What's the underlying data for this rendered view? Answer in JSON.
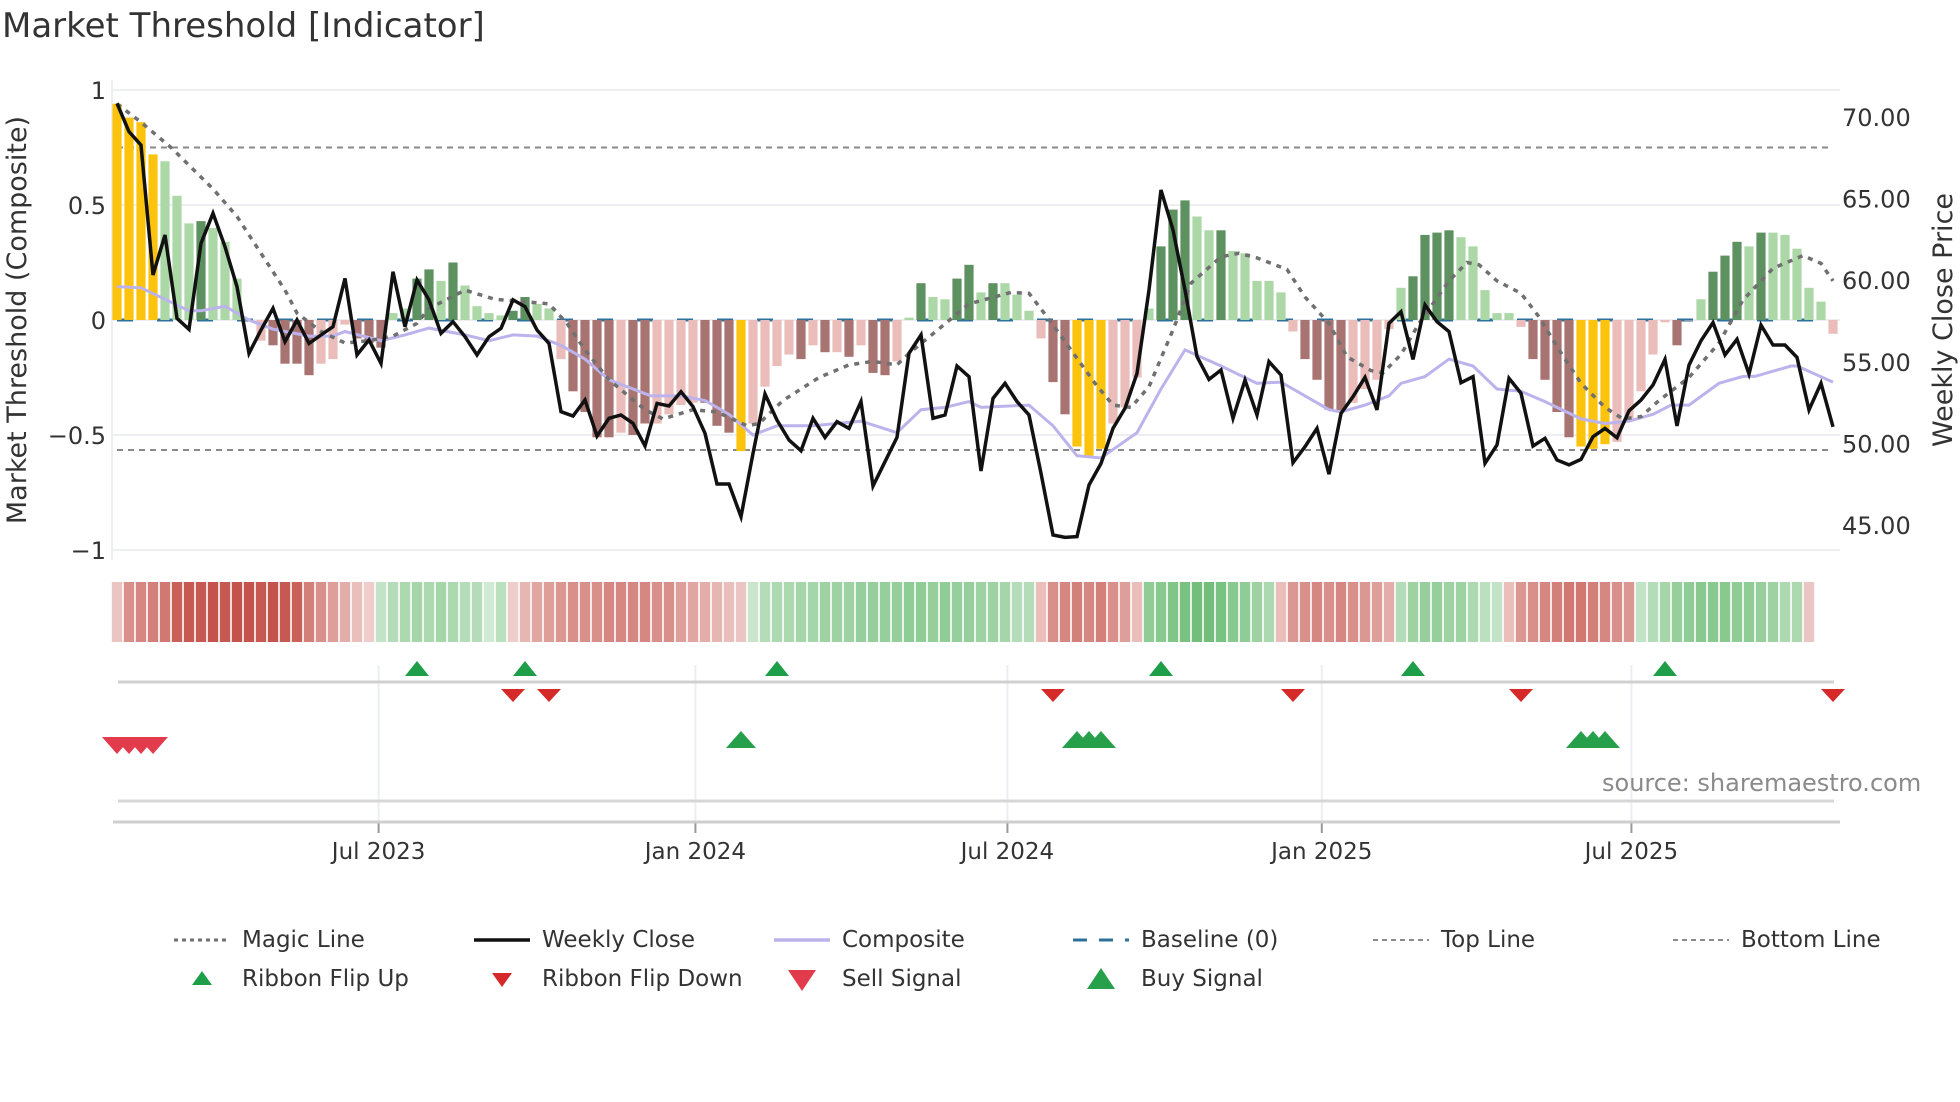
{
  "title": "Market Threshold [Indicator]",
  "source": "source: sharemaestro.com",
  "legend": {
    "magic": "Magic Line",
    "close": "Weekly Close",
    "composite": "Composite",
    "baseline": "Baseline (0)",
    "top": "Top Line",
    "bottom": "Bottom Line",
    "flip_up": "Ribbon Flip Up",
    "flip_down": "Ribbon Flip Down",
    "sell": "Sell Signal",
    "buy": "Buy Signal"
  },
  "colors": {
    "extreme": "#fcc30c",
    "strong_up": "#5e9160",
    "weak_up": "#acd7a6",
    "strong_down": "#a87471",
    "weak_down": "#eabdba",
    "close": "#111111",
    "composite": "#bdb3ec",
    "magic": "#707070",
    "baseline": "#2f6f9a",
    "ribbon_green": "#5fb567",
    "ribbon_red": "#c4534b",
    "flip_up": "#1e9e48",
    "flip_down": "#d62a2a",
    "sell": "#e23b4b",
    "buy": "#27a04c"
  },
  "chart_data": {
    "type": "bar",
    "title": "Market Threshold [Indicator]",
    "ylabel": "Market Threshold (Composite)",
    "y2label": "Weekly Close Price",
    "ylim": [
      -1,
      1
    ],
    "y2lim": [
      43.3,
      71.8
    ],
    "yticks": [
      {
        "v": 1,
        "label": "1"
      },
      {
        "v": 0.5,
        "label": "0.5"
      },
      {
        "v": 0,
        "label": "0"
      },
      {
        "v": -0.5,
        "label": "−0.5"
      },
      {
        "v": -1,
        "label": "−1"
      }
    ],
    "y2ticks": [
      {
        "v": 70,
        "label": "70.00"
      },
      {
        "v": 65,
        "label": "65.00"
      },
      {
        "v": 60,
        "label": "60.00"
      },
      {
        "v": 55,
        "label": "55.00"
      },
      {
        "v": 50,
        "label": "50.00"
      },
      {
        "v": 45,
        "label": "45.00"
      }
    ],
    "x_unit": "week index",
    "xticks": [
      {
        "v": 21.8,
        "label": "Jul 2023"
      },
      {
        "v": 48.2,
        "label": "Jan 2024"
      },
      {
        "v": 74.2,
        "label": "Jul 2024"
      },
      {
        "v": 100.4,
        "label": "Jan 2025"
      },
      {
        "v": 126.2,
        "label": "Jul 2025"
      }
    ],
    "top_line": 0.75,
    "bottom_line": -0.565,
    "baseline": 0,
    "composite_bars": [
      0.94,
      0.88,
      0.86,
      0.72,
      0.69,
      0.54,
      0.42,
      0.43,
      0.4,
      0.34,
      0.18,
      0.0,
      -0.09,
      -0.11,
      -0.19,
      -0.19,
      -0.24,
      -0.19,
      -0.17,
      -0.02,
      -0.08,
      -0.1,
      -0.12,
      0.03,
      0.05,
      0.18,
      0.22,
      0.17,
      0.25,
      0.15,
      0.06,
      0.03,
      0.02,
      0.04,
      0.1,
      0.07,
      0.05,
      -0.17,
      -0.31,
      -0.4,
      -0.51,
      -0.51,
      -0.49,
      -0.5,
      -0.45,
      -0.45,
      -0.41,
      -0.37,
      -0.36,
      -0.36,
      -0.46,
      -0.49,
      -0.57,
      -0.45,
      -0.29,
      -0.2,
      -0.15,
      -0.17,
      -0.11,
      -0.14,
      -0.14,
      -0.16,
      -0.11,
      -0.23,
      -0.24,
      -0.18,
      0.01,
      0.16,
      0.1,
      0.09,
      0.18,
      0.24,
      0.12,
      0.16,
      0.16,
      0.11,
      0.04,
      -0.08,
      -0.27,
      -0.41,
      -0.55,
      -0.59,
      -0.56,
      -0.45,
      -0.38,
      -0.25,
      0.05,
      0.32,
      0.48,
      0.52,
      0.45,
      0.39,
      0.39,
      0.3,
      0.29,
      0.17,
      0.17,
      0.12,
      -0.05,
      -0.17,
      -0.26,
      -0.39,
      -0.4,
      -0.36,
      -0.3,
      -0.26,
      -0.04,
      0.14,
      0.19,
      0.37,
      0.38,
      0.39,
      0.36,
      0.32,
      0.13,
      0.03,
      0.03,
      -0.03,
      -0.17,
      -0.26,
      -0.4,
      -0.51,
      -0.55,
      -0.56,
      -0.54,
      -0.53,
      -0.43,
      -0.31,
      -0.15,
      -0.01,
      -0.11,
      0.0,
      0.09,
      0.21,
      0.28,
      0.34,
      0.32,
      0.38,
      0.38,
      0.37,
      0.31,
      0.14,
      0.08,
      -0.06
    ],
    "bar_classes": "yyyyLLLDLLLLpddddpppdddLLDDLDLLLLDDLLpddddpddppppdddyppppdpdpdpddpLDLLDDLDLLLpddyyypppLDDDLLDLLLLLpddddppppLDDDDLLLLLpddddyyypppppdpLDDDLDLLLLLp",
    "bar_class_legend": {
      "y": "extreme",
      "D": "strong_up",
      "L": "weak_up",
      "d": "strong_down",
      "p": "weak_down"
    },
    "weekly_close": [
      70.84,
      69.1,
      68.28,
      60.32,
      62.77,
      57.66,
      56.99,
      62.26,
      64.1,
      62.05,
      59.6,
      55.52,
      56.95,
      58.28,
      56.24,
      57.56,
      56.13,
      56.64,
      57.15,
      60.11,
      55.42,
      56.34,
      54.9,
      60.52,
      57.15,
      60.01,
      58.79,
      56.74,
      57.46,
      56.54,
      55.42,
      56.54,
      57.05,
      58.79,
      58.38,
      56.95,
      56.13,
      51.94,
      51.68,
      52.66,
      50.45,
      51.54,
      51.74,
      51.23,
      49.84,
      52.45,
      52.29,
      53.17,
      52.25,
      50.62,
      47.51,
      47.51,
      45.51,
      49.39,
      53.03,
      51.43,
      50.21,
      49.55,
      51.54,
      50.37,
      51.33,
      50.92,
      52.56,
      47.39,
      48.88,
      50.37,
      55.52,
      56.64,
      51.54,
      51.74,
      54.74,
      54.09,
      48.31,
      52.76,
      53.68,
      52.56,
      51.74,
      48.17,
      44.39,
      44.24,
      44.29,
      47.45,
      48.77,
      50.92,
      52.15,
      54.29,
      59.4,
      65.53,
      63.08,
      59.4,
      55.32,
      53.92,
      54.5,
      51.54,
      53.88,
      51.74,
      55.01,
      54.19,
      48.82,
      49.8,
      50.92,
      48.11,
      51.84,
      52.86,
      54.05,
      52.05,
      57.36,
      58.07,
      55.15,
      58.48,
      57.46,
      56.85,
      53.72,
      54.09,
      48.78,
      49.9,
      53.99,
      53.07,
      49.84,
      50.31,
      48.98,
      48.68,
      49.02,
      50.41,
      50.92,
      50.35,
      52.0,
      52.66,
      53.58,
      55.15,
      51.07,
      54.8,
      56.29,
      57.4,
      55.42,
      56.38,
      54.25,
      57.25,
      56.03,
      56.03,
      55.27,
      52.05,
      53.68,
      51.02
    ],
    "composite_line": [
      [
        0,
        0.145
      ],
      [
        2,
        0.14
      ],
      [
        4,
        0.09
      ],
      [
        6,
        0.04
      ],
      [
        7,
        0.04
      ],
      [
        9,
        0.06
      ],
      [
        11,
        0.0
      ],
      [
        13,
        -0.04
      ],
      [
        16,
        -0.07
      ],
      [
        18,
        -0.07
      ],
      [
        19,
        -0.05
      ],
      [
        22,
        -0.09
      ],
      [
        24,
        -0.065
      ],
      [
        26,
        -0.035
      ],
      [
        29,
        -0.065
      ],
      [
        31,
        -0.09
      ],
      [
        33,
        -0.065
      ],
      [
        35,
        -0.07
      ],
      [
        37,
        -0.11
      ],
      [
        39,
        -0.17
      ],
      [
        41,
        -0.26
      ],
      [
        44.5,
        -0.33
      ],
      [
        47,
        -0.33
      ],
      [
        49,
        -0.35
      ],
      [
        51,
        -0.41
      ],
      [
        53,
        -0.5
      ],
      [
        55,
        -0.46
      ],
      [
        58,
        -0.46
      ],
      [
        62,
        -0.44
      ],
      [
        65,
        -0.49
      ],
      [
        67,
        -0.39
      ],
      [
        69,
        -0.38
      ],
      [
        71,
        -0.355
      ],
      [
        72,
        -0.38
      ],
      [
        76,
        -0.37
      ],
      [
        78,
        -0.46
      ],
      [
        80,
        -0.59
      ],
      [
        82,
        -0.6
      ],
      [
        85,
        -0.49
      ],
      [
        87,
        -0.3
      ],
      [
        89,
        -0.13
      ],
      [
        92,
        -0.2
      ],
      [
        95,
        -0.275
      ],
      [
        97,
        -0.27
      ],
      [
        101,
        -0.39
      ],
      [
        102,
        -0.4
      ],
      [
        104,
        -0.37
      ],
      [
        106,
        -0.33
      ],
      [
        107,
        -0.275
      ],
      [
        109,
        -0.246
      ],
      [
        111,
        -0.17
      ],
      [
        113,
        -0.2
      ],
      [
        115,
        -0.3
      ],
      [
        117,
        -0.31
      ],
      [
        119,
        -0.355
      ],
      [
        122,
        -0.43
      ],
      [
        124,
        -0.45
      ],
      [
        126,
        -0.44
      ],
      [
        128,
        -0.41
      ],
      [
        129.5,
        -0.37
      ],
      [
        131,
        -0.37
      ],
      [
        133.5,
        -0.275
      ],
      [
        135.5,
        -0.245
      ],
      [
        136.5,
        -0.245
      ],
      [
        139.5,
        -0.2
      ],
      [
        140,
        -0.2
      ],
      [
        143,
        -0.27
      ]
    ],
    "magic_line": [
      [
        0,
        0.94
      ],
      [
        2,
        0.86
      ],
      [
        4.5,
        0.75
      ],
      [
        8,
        0.57
      ],
      [
        10,
        0.45
      ],
      [
        12,
        0.29
      ],
      [
        14,
        0.13
      ],
      [
        15,
        0.03
      ],
      [
        17,
        -0.05
      ],
      [
        19,
        -0.1
      ],
      [
        21,
        -0.09
      ],
      [
        23,
        -0.07
      ],
      [
        25,
        -0.015
      ],
      [
        26,
        0.05
      ],
      [
        29,
        0.13
      ],
      [
        31.5,
        0.09
      ],
      [
        34,
        0.08
      ],
      [
        36,
        0.07
      ],
      [
        37.5,
        -0.015
      ],
      [
        39,
        -0.13
      ],
      [
        41,
        -0.26
      ],
      [
        44,
        -0.39
      ],
      [
        45.5,
        -0.43
      ],
      [
        48,
        -0.39
      ],
      [
        50,
        -0.4
      ],
      [
        52.5,
        -0.46
      ],
      [
        53.5,
        -0.45
      ],
      [
        55.5,
        -0.35
      ],
      [
        58.5,
        -0.25
      ],
      [
        61,
        -0.195
      ],
      [
        63,
        -0.18
      ],
      [
        65,
        -0.195
      ],
      [
        66,
        -0.145
      ],
      [
        68,
        -0.06
      ],
      [
        71,
        0.07
      ],
      [
        74.5,
        0.12
      ],
      [
        76,
        0.116
      ],
      [
        77.5,
        0.014
      ],
      [
        79.5,
        -0.13
      ],
      [
        81.5,
        -0.275
      ],
      [
        83,
        -0.37
      ],
      [
        84.5,
        -0.38
      ],
      [
        86,
        -0.29
      ],
      [
        88,
        -0.043
      ],
      [
        89.5,
        0.16
      ],
      [
        92,
        0.275
      ],
      [
        93.5,
        0.29
      ],
      [
        95,
        0.27
      ],
      [
        97.5,
        0.22
      ],
      [
        99,
        0.1
      ],
      [
        101,
        -0.015
      ],
      [
        102.5,
        -0.16
      ],
      [
        104.5,
        -0.22
      ],
      [
        105.5,
        -0.23
      ],
      [
        107,
        -0.15
      ],
      [
        108.5,
        -0.015
      ],
      [
        111,
        0.17
      ],
      [
        112.5,
        0.25
      ],
      [
        113.5,
        0.24
      ],
      [
        115,
        0.17
      ],
      [
        117,
        0.116
      ],
      [
        118.5,
        0.014
      ],
      [
        120,
        -0.116
      ],
      [
        122,
        -0.275
      ],
      [
        124,
        -0.38
      ],
      [
        125.5,
        -0.43
      ],
      [
        127,
        -0.42
      ],
      [
        128.5,
        -0.35
      ],
      [
        131,
        -0.25
      ],
      [
        133.5,
        -0.1
      ],
      [
        135.5,
        0.087
      ],
      [
        138,
        0.225
      ],
      [
        140.5,
        0.28
      ],
      [
        142,
        0.246
      ],
      [
        143,
        0.17
      ]
    ],
    "ribbon": [
      -0.15,
      -0.5,
      -0.55,
      -0.6,
      -0.65,
      -0.8,
      -0.85,
      -0.85,
      -0.9,
      -0.85,
      -0.9,
      -0.9,
      -0.85,
      -0.9,
      -0.85,
      -0.8,
      -0.6,
      -0.5,
      -0.4,
      -0.3,
      -0.2,
      -0.1,
      0.2,
      0.3,
      0.35,
      0.4,
      0.35,
      0.4,
      0.35,
      0.3,
      0.3,
      0.1,
      0.25,
      -0.1,
      -0.25,
      -0.35,
      -0.4,
      -0.45,
      -0.5,
      -0.5,
      -0.5,
      -0.55,
      -0.55,
      -0.55,
      -0.55,
      -0.5,
      -0.5,
      -0.4,
      -0.35,
      -0.3,
      -0.25,
      -0.2,
      -0.15,
      0.15,
      0.3,
      0.35,
      0.35,
      0.4,
      0.4,
      0.45,
      0.45,
      0.45,
      0.5,
      0.5,
      0.5,
      0.5,
      0.55,
      0.55,
      0.5,
      0.55,
      0.5,
      0.5,
      0.45,
      0.45,
      0.4,
      0.3,
      0.3,
      -0.2,
      -0.5,
      -0.55,
      -0.6,
      -0.55,
      -0.6,
      -0.5,
      -0.4,
      -0.2,
      0.55,
      0.6,
      0.65,
      0.7,
      0.75,
      0.75,
      0.7,
      0.6,
      0.55,
      0.45,
      0.35,
      -0.2,
      -0.45,
      -0.5,
      -0.55,
      -0.5,
      -0.55,
      -0.5,
      -0.45,
      -0.4,
      -0.3,
      0.3,
      0.45,
      0.5,
      0.5,
      0.45,
      0.45,
      0.35,
      0.25,
      0.2,
      -0.2,
      -0.45,
      -0.5,
      -0.55,
      -0.6,
      -0.65,
      -0.65,
      -0.6,
      -0.55,
      -0.5,
      -0.45,
      0.2,
      0.3,
      0.4,
      0.5,
      0.55,
      0.6,
      0.6,
      0.6,
      0.55,
      0.55,
      0.5,
      0.45,
      0.35,
      0.35,
      -0.15
    ],
    "ribbon_flip_up": [
      25,
      34,
      55,
      87,
      108,
      129
    ],
    "ribbon_flip_down": [
      33,
      36,
      78,
      98,
      117,
      143
    ],
    "sell_signals": [
      0,
      1,
      2,
      3
    ],
    "buy_signals": [
      52,
      80,
      81,
      82,
      122,
      123,
      124
    ],
    "legend_position": "bottom"
  }
}
